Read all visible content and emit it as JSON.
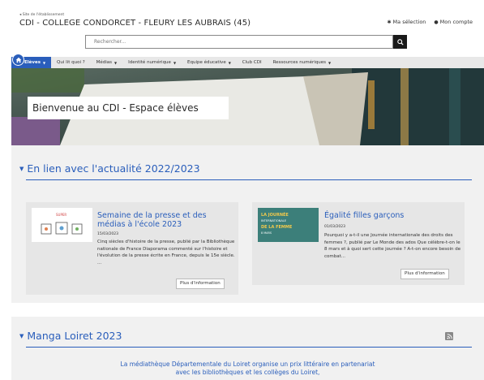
{
  "header": {
    "parent_link": "◂ Site de l'établissement",
    "site_title": "CDI - COLLEGE CONDORCET - FLEURY LES AUBRAIS (45)",
    "my_selection": "Ma sélection",
    "my_account": "Mon compte"
  },
  "search": {
    "placeholder": "Rechercher...",
    "icon": "search-icon"
  },
  "nav": {
    "items": [
      {
        "label": "Elèves",
        "active": true
      },
      {
        "label": "Qui lit quoi ?",
        "active": false
      },
      {
        "label": "Médias",
        "active": false
      },
      {
        "label": "Identité numérique",
        "active": false
      },
      {
        "label": "Equipe éducative",
        "active": false
      },
      {
        "label": "Club CDI",
        "active": false
      },
      {
        "label": "Ressources numériques",
        "active": false
      }
    ]
  },
  "hero": {
    "banner": "Bienvenue au CDI - Espace élèves"
  },
  "news_section": {
    "title": "En lien avec l'actualité 2022/2023",
    "cards": [
      {
        "title": "Semaine de la presse et des médias à l'école 2023",
        "date": "15/03/2023",
        "body": "Cinq siècles d'histoire de la presse, publié par la Bibliothèque nationale de France Diaporama commenté sur l'histoire et l'évolution de la presse écrite en France, depuis le 15e siècle. ...",
        "more": "Plus d'information",
        "thumb_text": "SUPER"
      },
      {
        "title": "Égalité filles garçons",
        "date": "01/03/2023",
        "body": "Pourquoi y a-t-il une Journée internationale des droits des femmes ?, publié par Le Monde des ados Que célèbre-t-on le 8 mars et à quoi sert cette journée ? A-t-on encore besoin de combat...",
        "more": "Plus d'information",
        "thumb_lines": [
          "LA JOURNÉE",
          "INTERNATIONALE",
          "DE LA FEMME",
          "8 MARS"
        ]
      }
    ]
  },
  "manga_section": {
    "title": "Manga Loiret 2023",
    "text_line1": "La médiathèque Départementale du Loiret organise un prix littéraire en partenariat",
    "text_line2": "avec les bibliothèques et les collèges du Loiret,"
  },
  "colors": {
    "accent": "#2a5ebb",
    "nav_bg": "#e8e8e8",
    "main_bg": "#f1f1f1",
    "card_bg": "#e6e6e6"
  }
}
